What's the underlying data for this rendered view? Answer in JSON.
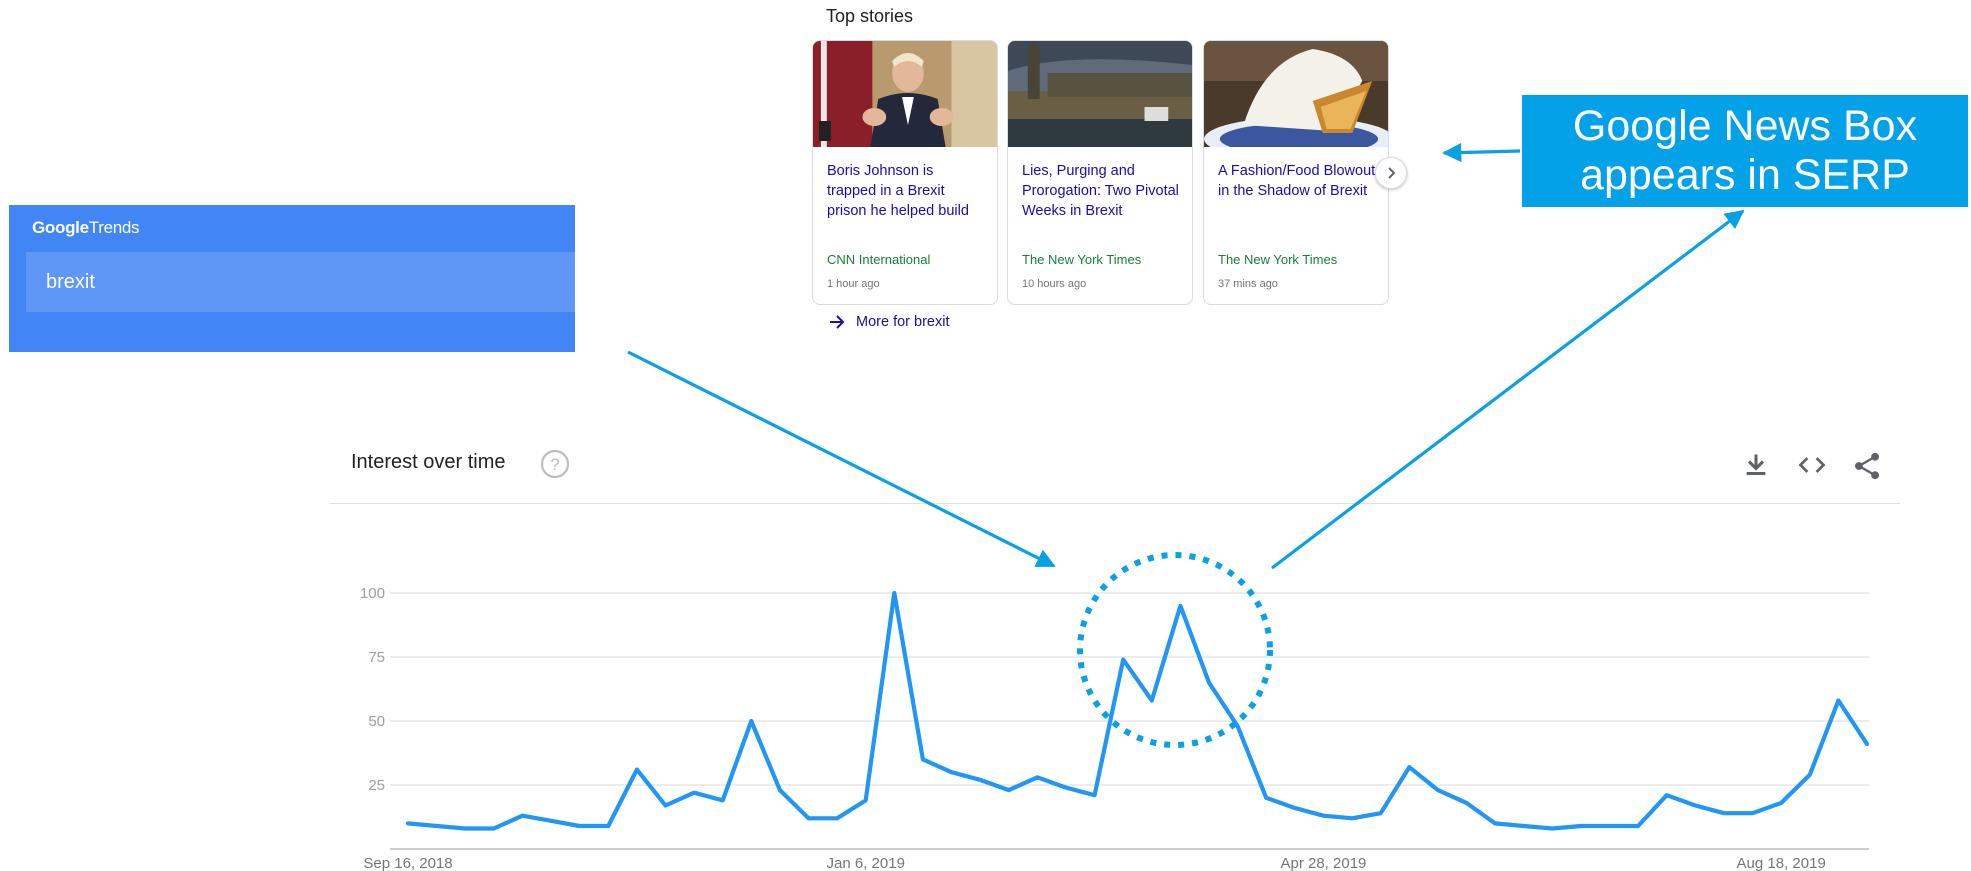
{
  "trends": {
    "logo_google": "Google",
    "logo_trends": "Trends",
    "search_value": "brexit"
  },
  "top_stories": {
    "title": "Top stories",
    "cards": [
      {
        "headline": "Boris Johnson is trapped in a Brexit prison he helped build",
        "source": "CNN International",
        "time": "1 hour ago"
      },
      {
        "headline": "Lies, Purging and Prorogation: Two Pivotal Weeks in Brexit",
        "source": "The New York Times",
        "time": "10 hours ago"
      },
      {
        "headline": "A Fashion/Food Blowout in the Shadow of Brexit",
        "source": "The New York Times",
        "time": "37 mins ago"
      }
    ],
    "more_link": "More for brexit"
  },
  "callout": {
    "line1": "Google News Box",
    "line2": "appears in SERP"
  },
  "chart_section": {
    "title": "Interest over time"
  },
  "colors": {
    "trends_blue": "#4285f4",
    "callout_blue": "#03a1e7",
    "line_blue": "#2196f3"
  },
  "chart_data": {
    "type": "line",
    "title": "Interest over time",
    "xlabel": "",
    "ylabel": "",
    "ylim": [
      0,
      100
    ],
    "yticks": [
      25,
      50,
      75,
      100
    ],
    "x_tick_labels": [
      "Sep 16, 2018",
      "Jan 6, 2019",
      "Apr 28, 2019",
      "Aug 18, 2019"
    ],
    "x_tick_indices": [
      0,
      16,
      32,
      48
    ],
    "grid": true,
    "series": [
      {
        "values": [
          10,
          9,
          8,
          8,
          13,
          11,
          9,
          9,
          31,
          17,
          22,
          19,
          50,
          23,
          12,
          12,
          19,
          100,
          35,
          30,
          27,
          23,
          28,
          24,
          21,
          74,
          58,
          95,
          65,
          48,
          20,
          16,
          13,
          12,
          14,
          32,
          23,
          18,
          10,
          9,
          8,
          9,
          9,
          9,
          21,
          17,
          14,
          14,
          18,
          29,
          58,
          41
        ]
      }
    ]
  }
}
